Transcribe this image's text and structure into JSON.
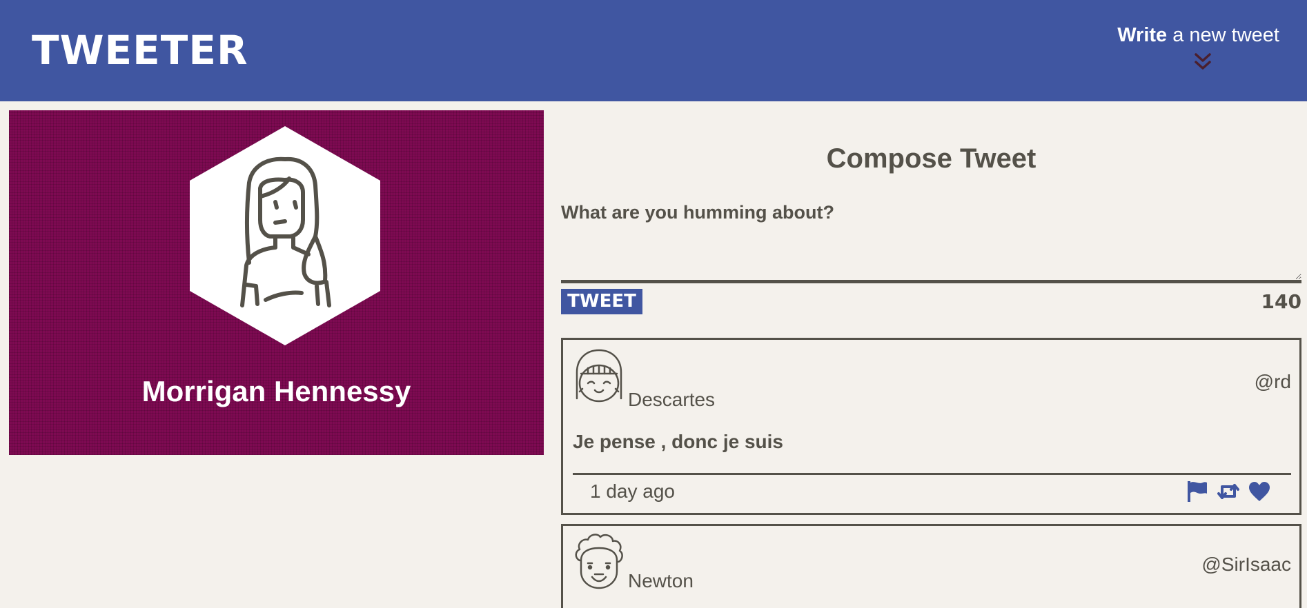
{
  "nav": {
    "brand": "TWEETER",
    "write_bold": "Write",
    "write_rest": " a new tweet",
    "toggle_icon": "double-chevron-down-icon",
    "background": "#4056a1"
  },
  "profile": {
    "name": "Morrigan Hennessy",
    "avatar_icon": "woman-avatar-icon",
    "background": "#7e0a52"
  },
  "compose": {
    "title": "Compose Tweet",
    "placeholder": "What are you humming about?",
    "value": "",
    "button_label": "TWEET",
    "counter": "140"
  },
  "tweets": [
    {
      "author": "Descartes",
      "handle": "@rd",
      "content": "Je pense , donc je suis",
      "timestamp": "1 day ago",
      "avatar_icon": "girl-face-avatar-icon",
      "actions": [
        "flag-icon",
        "retweet-icon",
        "heart-icon"
      ]
    },
    {
      "author": "Newton",
      "handle": "@SirIsaac",
      "avatar_icon": "curly-hair-face-avatar-icon"
    }
  ],
  "colors": {
    "accent": "#4056a1",
    "text": "#545149",
    "page_bg": "#f4f1ec"
  }
}
